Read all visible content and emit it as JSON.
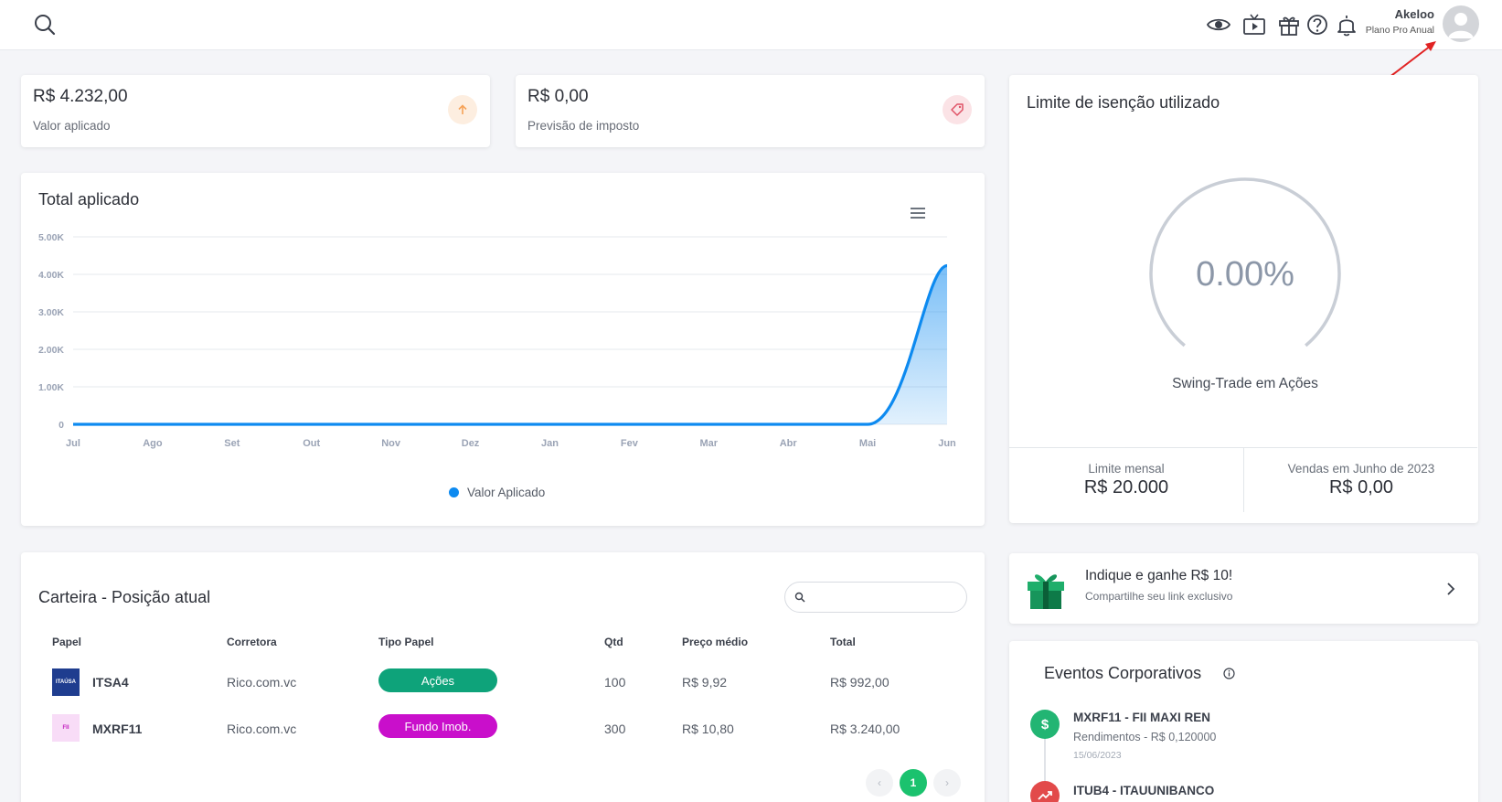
{
  "user": {
    "name": "Akeloo",
    "plan": "Plano Pro Anual"
  },
  "stats": [
    {
      "value": "R$ 4.232,00",
      "label": "Valor aplicado",
      "icon": "arrow-up-icon",
      "icon_color": "#f6a257",
      "icon_bg": "#fdeee0"
    },
    {
      "value": "R$ 0,00",
      "label": "Previsão de imposto",
      "icon": "tag-icon",
      "icon_color": "#e05367",
      "icon_bg": "#fbe3e6"
    }
  ],
  "total_chart": {
    "title": "Total aplicado",
    "legend": "Valor Aplicado"
  },
  "chart_data": {
    "type": "area",
    "title": "Total aplicado",
    "xlabel": "",
    "ylabel": "",
    "categories": [
      "Jul",
      "Ago",
      "Set",
      "Out",
      "Nov",
      "Dez",
      "Jan",
      "Fev",
      "Mar",
      "Abr",
      "Mai",
      "Jun"
    ],
    "y_ticks": [
      "0",
      "1.00K",
      "2.00K",
      "3.00K",
      "4.00K",
      "5.00K"
    ],
    "ylim": [
      0,
      5000
    ],
    "series": [
      {
        "name": "Valor Aplicado",
        "color": "#0d8af0",
        "values": [
          0,
          0,
          0,
          0,
          0,
          0,
          0,
          0,
          0,
          0,
          0,
          4232
        ]
      }
    ],
    "grid": true,
    "legend_position": "bottom"
  },
  "exemption": {
    "title": "Limite de isenção utilizado",
    "percent": "0.00%",
    "percent_value": 0,
    "caption": "Swing-Trade em Ações",
    "monthly_label": "Limite mensal",
    "monthly_value": "R$ 20.000",
    "sales_label": "Vendas em Junho de 2023",
    "sales_value": "R$ 0,00"
  },
  "referral": {
    "title": "Indique e ganhe R$ 10!",
    "subtitle": "Compartilhe seu link exclusivo"
  },
  "portfolio": {
    "title": "Carteira - Posição atual",
    "search_placeholder": "",
    "columns": [
      "Papel",
      "Corretora",
      "Tipo Papel",
      "Qtd",
      "Preço médio",
      "Total"
    ],
    "rows": [
      {
        "ticker": "ITSA4",
        "logo": "ITAÚSA",
        "logo_bg": "#1f3d8f",
        "logo_fg": "#ffffff",
        "broker": "Rico.com.vc",
        "type": "Ações",
        "type_color": "#0ea37a",
        "qty": "100",
        "avg_price": "R$ 9,92",
        "total": "R$ 992,00"
      },
      {
        "ticker": "MXRF11",
        "logo": "FII",
        "logo_bg": "#f8dcf7",
        "logo_fg": "#c21fbf",
        "broker": "Rico.com.vc",
        "type": "Fundo Imob.",
        "type_color": "#c90fcb",
        "qty": "300",
        "avg_price": "R$ 10,80",
        "total": "R$ 3.240,00"
      }
    ],
    "pagination": {
      "prev": "‹",
      "current": "1",
      "next": "›"
    }
  },
  "events": {
    "title": "Eventos Corporativos",
    "items": [
      {
        "name": "MXRF11 - FII MAXI REN",
        "desc": "Rendimentos - R$ 0,120000",
        "date": "15/06/2023",
        "icon": "dollar-icon",
        "color": "#22b573"
      },
      {
        "name": "ITUB4 - ITAUUNIBANCO",
        "desc": "",
        "date": "",
        "icon": "trend-up-icon",
        "color": "#e24a4a"
      }
    ]
  }
}
